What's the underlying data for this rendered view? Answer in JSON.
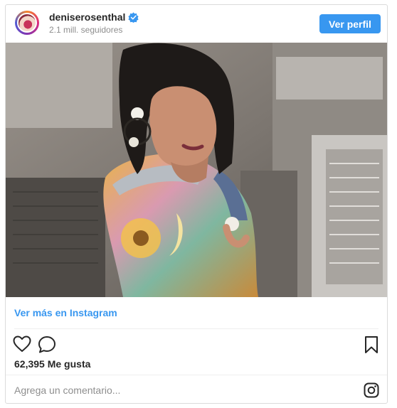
{
  "profile": {
    "username": "deniserosenthal",
    "followers": "2.1 mill. seguidores",
    "view_profile_label": "Ver perfil"
  },
  "post": {
    "view_more_label": "Ver más en Instagram",
    "likes": "62,395 Me gusta",
    "comment_placeholder": "Agrega un comentario..."
  },
  "colors": {
    "accent": "#3897f0",
    "verified": "#3897f0",
    "border": "#dbdbdb"
  },
  "icons": {
    "verified": "verified-badge-icon",
    "like": "heart-icon",
    "comment": "comment-bubble-icon",
    "save": "bookmark-icon",
    "instagram": "instagram-logo-icon"
  }
}
